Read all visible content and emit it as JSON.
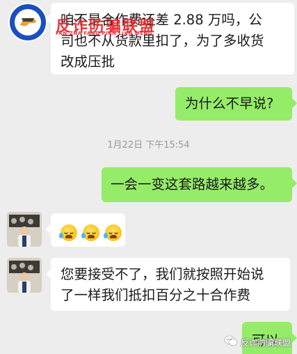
{
  "chat": {
    "messages": [
      {
        "id": "m1",
        "side": "in",
        "lines": [
          "咱不是合作费还差 2.88 万吗，公",
          "司也不从货款里扣了，为了多收货",
          "改成压批"
        ]
      },
      {
        "id": "m2",
        "side": "out",
        "lines": [
          "为什么不早说?"
        ]
      },
      {
        "id": "m3",
        "side": "out",
        "lines": [
          "一会一变这套路越来越多。"
        ]
      },
      {
        "id": "m4",
        "side": "in",
        "emoji": [
          "loudly-crying-face",
          "loudly-crying-face",
          "loudly-crying-face"
        ]
      },
      {
        "id": "m5",
        "side": "in",
        "lines": [
          "您要接受不了，我们就按照开始说",
          "了一样我们抵扣百分之十合作费"
        ]
      },
      {
        "id": "m6",
        "side": "out",
        "lines": [
          "可以"
        ]
      }
    ],
    "timestamp": "1月22日 下午15:54"
  },
  "watermark": {
    "title": "反诈防骗联盟",
    "subtitle": "FAN ZHA FANG PIAN LIAN MENG",
    "footer": "反诈防骗联盟",
    "brand_color": "#e8242a"
  }
}
